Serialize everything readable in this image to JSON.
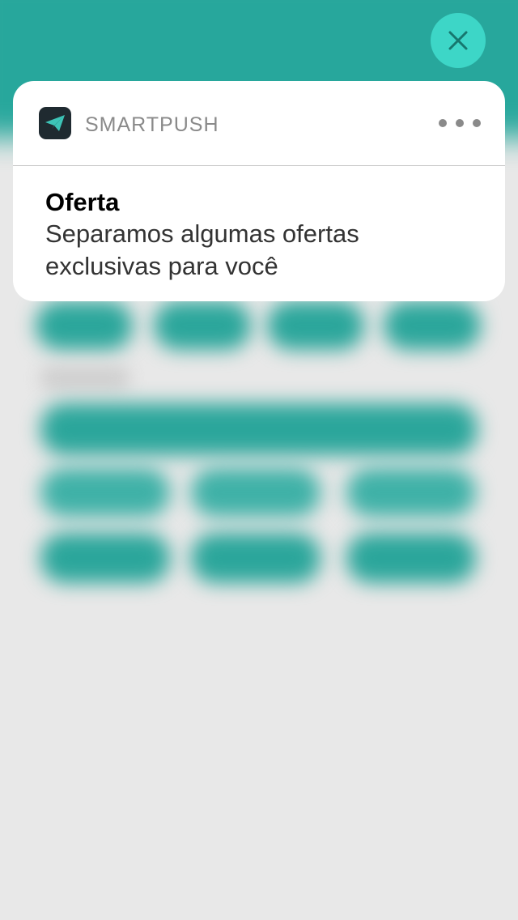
{
  "notification": {
    "app_name": "SMARTPUSH",
    "app_icon": "paper-plane-icon",
    "title": "Oferta",
    "message": "Separamos algumas ofertas exclusivas para você"
  },
  "controls": {
    "close_icon": "close-icon",
    "more_icon": "ellipsis-icon"
  },
  "colors": {
    "accent": "#27a79c",
    "close_button_bg": "#3dd6c7",
    "close_icon": "#17776e",
    "app_icon_bg": "#1f2a30",
    "app_icon_glyph": "#3dc4b7"
  }
}
